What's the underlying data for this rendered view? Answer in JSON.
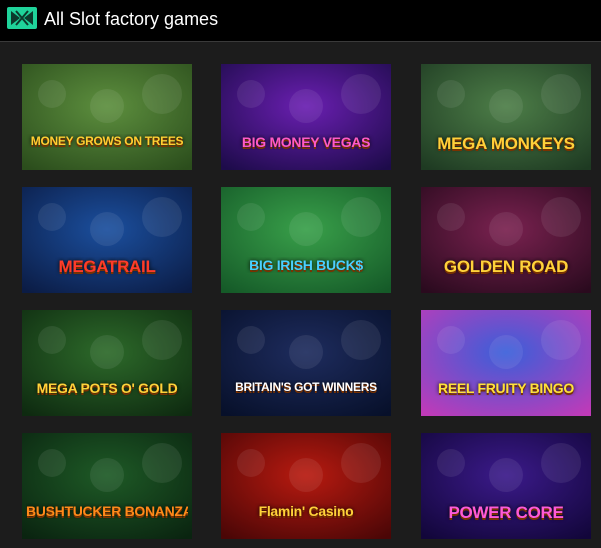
{
  "header": {
    "title": "All Slot factory games",
    "logo_icon": "slot-factory-logo-icon"
  },
  "games": [
    {
      "id": "money-grows-on-trees",
      "title": "MONEY GROWS ON TREES",
      "colors": [
        "#5d8f3e",
        "#2b4d1c"
      ],
      "text_color": "#ffcf33"
    },
    {
      "id": "big-money-vegas",
      "title": "BIG MONEY VEGAS",
      "colors": [
        "#6a1fb1",
        "#1d0b4a"
      ],
      "text_color": "#ff5ac8"
    },
    {
      "id": "mega-monkeys",
      "title": "MEGA MONKEYS",
      "colors": [
        "#4d7e48",
        "#1e3a22"
      ],
      "text_color": "#ffd03a"
    },
    {
      "id": "mega-trail",
      "title": "MEGATRAIL",
      "colors": [
        "#1b4f9e",
        "#0b1c45"
      ],
      "text_color": "#ff3b2a"
    },
    {
      "id": "big-irish-bucks",
      "title": "BIG IRISH BUCK$",
      "colors": [
        "#39a04a",
        "#155a28"
      ],
      "text_color": "#4ad0ff"
    },
    {
      "id": "golden-road",
      "title": "GOLDEN ROAD",
      "colors": [
        "#7a2250",
        "#2a0a1e"
      ],
      "text_color": "#ffd23a"
    },
    {
      "id": "mega-pots-of-gold",
      "title": "MEGA POTS O' GOLD",
      "colors": [
        "#2d6a2a",
        "#0e2a10"
      ],
      "text_color": "#ffd23a"
    },
    {
      "id": "britains-got-winners",
      "title": "BRITAIN'S GOT WINNERS",
      "colors": [
        "#1e2c5e",
        "#07102a"
      ],
      "text_color": "#ffffff"
    },
    {
      "id": "reel-fruity-bingo",
      "title": "REEL FRUITY BINGO",
      "colors": [
        "#3a5fd9",
        "#c03ab8"
      ],
      "text_color": "#ffe23a"
    },
    {
      "id": "bushtucker-bonanza",
      "title": "BUSHTUCKER BONANZA",
      "colors": [
        "#1e5a26",
        "#0a2410"
      ],
      "text_color": "#ff8a1a"
    },
    {
      "id": "flamin-casino",
      "title": "Flamin' Casino",
      "colors": [
        "#b81a10",
        "#4a0606"
      ],
      "text_color": "#ffd23a"
    },
    {
      "id": "power-core",
      "title": "POWER CORE",
      "colors": [
        "#3b1a8a",
        "#12063a"
      ],
      "text_color": "#ff5ad8"
    }
  ]
}
